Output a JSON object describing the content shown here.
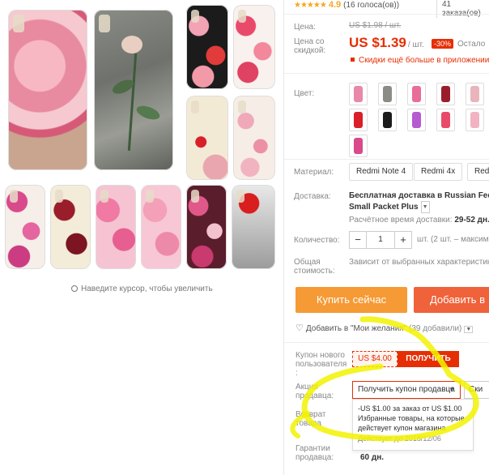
{
  "gallery": {
    "zoom_hint": "Наведите курсор, чтобы увеличить"
  },
  "rating": {
    "stars": "★★★★★",
    "score": "4.9",
    "votes": "(16 голоса(ов))",
    "orders": "41 заказа(ов)"
  },
  "price": {
    "label": "Цена:",
    "old": "US $1.98 / шт.",
    "discount_label": "Цена со скидкой:",
    "new": "US $1.39",
    "unit": "/ шт.",
    "discount": "-30%",
    "countdown": "Остало",
    "app_promo": "Скидки ещё больше в приложении"
  },
  "color": {
    "label": "Цвет:"
  },
  "material": {
    "label": "Материал:",
    "options": [
      "Redmi Note 4",
      "Redmi 4x",
      "Redm"
    ]
  },
  "shipping": {
    "label": "Доставка:",
    "line1": "Бесплатная доставка в Russian Feder",
    "line2": "Small Packet Plus",
    "time_label": "Расчётное время доставки:",
    "time_value": "29-52 дн."
  },
  "quantity": {
    "label": "Количество:",
    "minus": "−",
    "value": "1",
    "plus": "+",
    "note": "шт. (2 шт. – максиму"
  },
  "total": {
    "label": "Общая стоимость:",
    "note": "Зависит от выбранных характеристик"
  },
  "actions": {
    "buy_now": "Купить сейчас",
    "add_to_cart": "Добавить в",
    "wishlist": "Добавить в \"Мои желания\"",
    "wishlist_count": "(39 добавили)"
  },
  "coupon": {
    "new_user_label": "Купон нового пользователя :",
    "new_user_value": "US $4.00",
    "get_button": "ПОЛУЧИТЬ",
    "seller_label": "Акция продавца:",
    "seller_select": "Получить купон продавца",
    "seller_select2": "Ски",
    "popup_line1": "-US $1.00 за заказ от US $1.00",
    "popup_line2": "Избранные товары, на которые действует купон магазина",
    "popup_line3": "Действует до 2018/12/06"
  },
  "returns": {
    "label": "Возврат товара"
  },
  "guarantee": {
    "label": "Гарантии продавца:",
    "value": "60 дн."
  },
  "colors": {
    "accent": "#e62e04",
    "buy": "#f59a35",
    "cart": "#f0623a",
    "star": "#f5a623",
    "highlight": "#f2f200"
  }
}
